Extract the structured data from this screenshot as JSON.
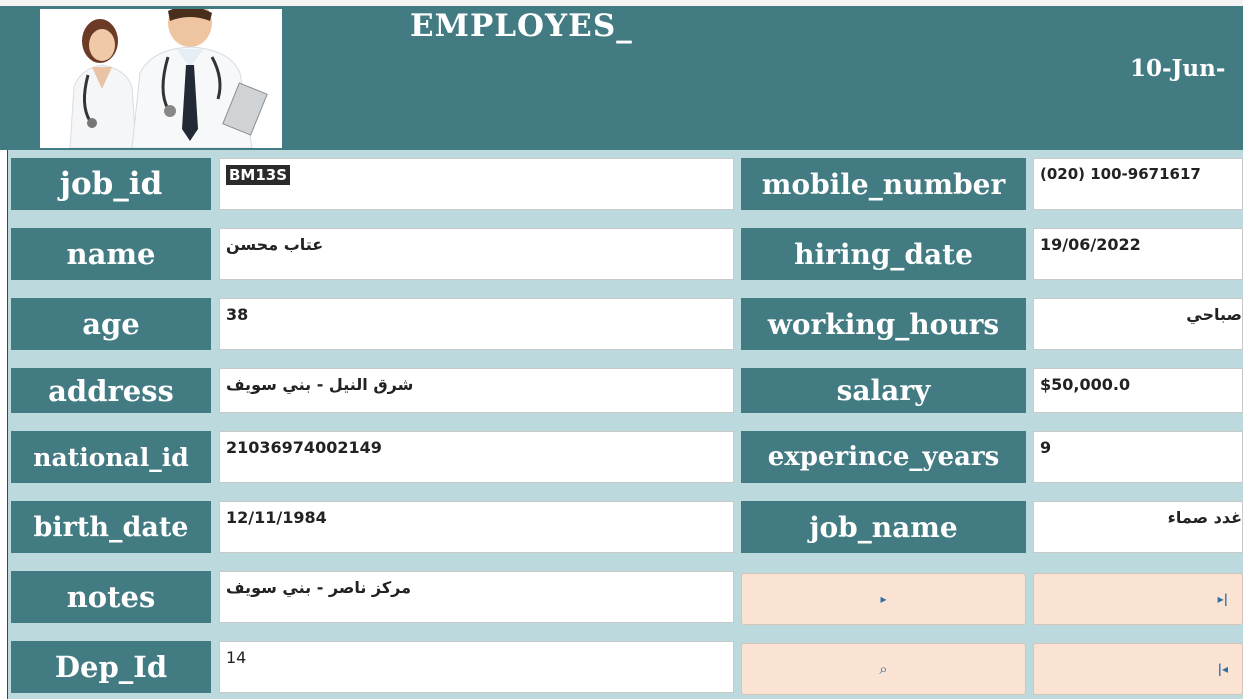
{
  "header": {
    "title": "EMPLOYES_",
    "date": "10-Jun-"
  },
  "fields": {
    "job_id": {
      "label": "job_id",
      "value": "BM13S"
    },
    "name": {
      "label": "name",
      "value": "عتاب محسن"
    },
    "age": {
      "label": "age",
      "value": "38"
    },
    "address": {
      "label": "address",
      "value": "شرق النيل - بني سويف"
    },
    "national_id": {
      "label": "national_id",
      "value": "21036974002149"
    },
    "birth_date": {
      "label": "birth_date",
      "value": "12/11/1984"
    },
    "notes": {
      "label": "notes",
      "value": "مركز ناصر - بني سويف"
    },
    "dep_id": {
      "label": "Dep_Id",
      "value": "14"
    },
    "mobile_number": {
      "label": "mobile_number",
      "value": "(020) 100-9671617"
    },
    "hiring_date": {
      "label": "hiring_date",
      "value": "19/06/2022"
    },
    "working_hours": {
      "label": "working_hours",
      "value": "صباحي"
    },
    "salary": {
      "label": "salary",
      "value": "$50,000.0"
    },
    "experince_years": {
      "label": "experince_years",
      "value": "9"
    },
    "job_name": {
      "label": "job_name",
      "value": "غدد صماء"
    }
  },
  "nav": {
    "next_icon": "▸",
    "last_icon": "▸|",
    "search_icon": "⌕",
    "first_icon": "|◂"
  },
  "colors": {
    "header_bg": "#437b83",
    "label_bg": "#437b83",
    "form_bg": "#bcdadd",
    "button_bg": "#fbe3d3",
    "nav_icon": "#2e6ea3"
  }
}
